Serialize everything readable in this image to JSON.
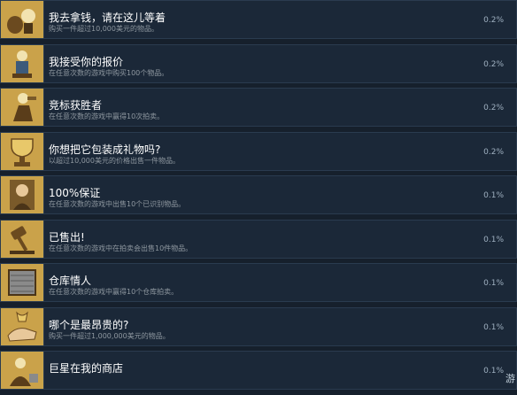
{
  "achievements": [
    {
      "title": "我去拿钱，请在这儿等着",
      "desc": "购买一件超过10,000美元的物品。",
      "pct": "0.2%",
      "icon": "money-bag-icon"
    },
    {
      "title": "我接受你的报价",
      "desc": "在任意次数的游戏中购买100个物品。",
      "pct": "0.2%",
      "icon": "trophy-figure-icon"
    },
    {
      "title": "竞标获胜者",
      "desc": "在任意次数的游戏中赢得10次拍卖。",
      "pct": "0.2%",
      "icon": "auction-winner-icon"
    },
    {
      "title": "你想把它包装成礼物吗?",
      "desc": "以超过10,000美元的价格出售一件物品。",
      "pct": "0.2%",
      "icon": "gift-trophy-icon"
    },
    {
      "title": "100%保证",
      "desc": "在任意次数的游戏中出售10个已识别物品。",
      "pct": "0.1%",
      "icon": "portrait-icon"
    },
    {
      "title": "已售出!",
      "desc": "在任意次数的游戏中在拍卖会出售10件物品。",
      "pct": "0.1%",
      "icon": "gavel-icon"
    },
    {
      "title": "仓库情人",
      "desc": "在任意次数的游戏中赢得10个仓库拍卖。",
      "pct": "0.1%",
      "icon": "warehouse-icon"
    },
    {
      "title": "哪个是最昂贵的?",
      "desc": "购买一件超过1,000,000美元的物品。",
      "pct": "0.1%",
      "icon": "treasure-hand-icon"
    },
    {
      "title": "巨星在我的商店",
      "desc": "",
      "pct": "0.1%",
      "icon": "store-star-icon"
    }
  ],
  "corner_text": "游",
  "colors": {
    "background": "#16202c",
    "row": "#1b2838",
    "icon_bg": "#c9a44a",
    "title": "#ffffff",
    "desc": "#8f98a0",
    "pct": "#9fb0c0"
  }
}
